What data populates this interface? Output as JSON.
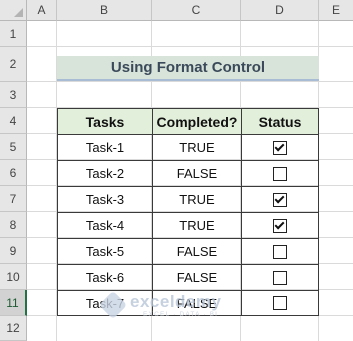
{
  "columns": [
    "A",
    "B",
    "C",
    "D",
    "E"
  ],
  "rows": [
    "1",
    "2",
    "3",
    "4",
    "5",
    "6",
    "7",
    "8",
    "9",
    "10",
    "11",
    "12"
  ],
  "active_row": "11",
  "title": "Using Format Control",
  "table": {
    "headers": [
      "Tasks",
      "Completed?",
      "Status"
    ],
    "rows": [
      {
        "task": "Task-1",
        "completed": "TRUE",
        "checked": true
      },
      {
        "task": "Task-2",
        "completed": "FALSE",
        "checked": false
      },
      {
        "task": "Task-3",
        "completed": "TRUE",
        "checked": true
      },
      {
        "task": "Task-4",
        "completed": "TRUE",
        "checked": true
      },
      {
        "task": "Task-5",
        "completed": "FALSE",
        "checked": false
      },
      {
        "task": "Task-6",
        "completed": "FALSE",
        "checked": false
      },
      {
        "task": "Task-7",
        "completed": "FALSE",
        "checked": false
      }
    ]
  },
  "watermark": {
    "brand": "exceldemy",
    "tagline": "EXCEL · DATA · BI"
  },
  "colors": {
    "header_fill": "#e2efda",
    "title_fill": "#d8e4d9",
    "active_accent": "#217346"
  }
}
